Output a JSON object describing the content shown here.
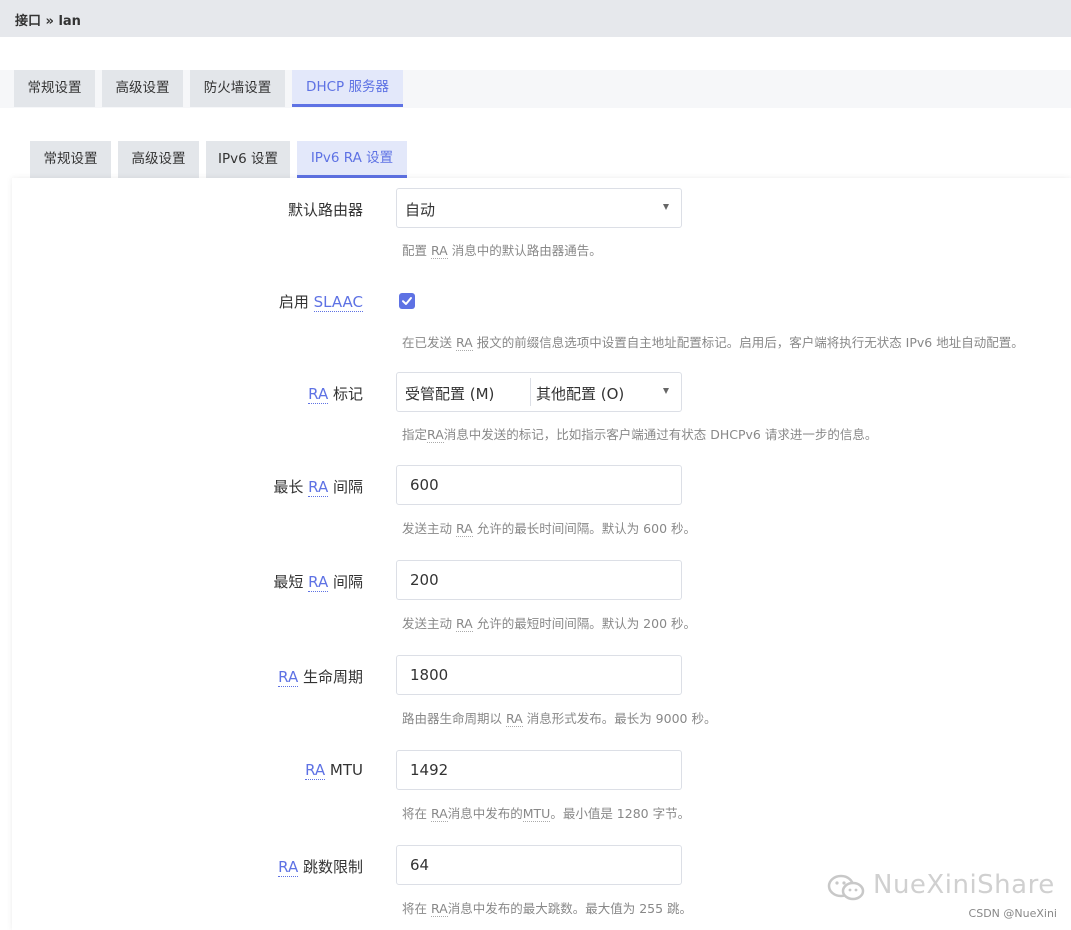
{
  "breadcrumb": "接口 » lan",
  "main_tabs": [
    "常规设置",
    "高级设置",
    "防火墙设置",
    "DHCP 服务器"
  ],
  "sub_tabs": [
    "常规设置",
    "高级设置",
    "IPv6 设置",
    "IPv6 RA 设置"
  ],
  "fields": {
    "default_router": {
      "label": "默认路由器",
      "value": "自动",
      "help_prefix": "配置 ",
      "help_abbr": "RA",
      "help_suffix": " 消息中的默认路由器通告。"
    },
    "slaac": {
      "label_prefix": "启用 ",
      "label_abbr": "SLAAC",
      "checked": true,
      "help_prefix": "在已发送 ",
      "help_abbr": "RA",
      "help_suffix": " 报文的前缀信息选项中设置自主地址配置标记。启用后，客户端将执行无状态 IPv6 地址自动配置。"
    },
    "ra_flags": {
      "label_abbr": "RA",
      "label_suffix": " 标记",
      "value1": "受管配置 (M)",
      "value2": "其他配置 (O)",
      "help_prefix": "指定",
      "help_abbr": "RA",
      "help_suffix": "消息中发送的标记，比如指示客户端通过有状态 DHCPv6 请求进一步的信息。"
    },
    "max_interval": {
      "label_prefix": "最长 ",
      "label_abbr": "RA",
      "label_suffix": " 间隔",
      "value": "600",
      "help_prefix": "发送主动 ",
      "help_abbr": "RA",
      "help_suffix": " 允许的最长时间间隔。默认为 600 秒。"
    },
    "min_interval": {
      "label_prefix": "最短 ",
      "label_abbr": "RA",
      "label_suffix": " 间隔",
      "value": "200",
      "help_prefix": "发送主动 ",
      "help_abbr": "RA",
      "help_suffix": " 允许的最短时间间隔。默认为 200 秒。"
    },
    "lifetime": {
      "label_abbr": "RA",
      "label_suffix": " 生命周期",
      "value": "1800",
      "help_prefix": "路由器生命周期以 ",
      "help_abbr": "RA",
      "help_suffix": " 消息形式发布。最长为 9000 秒。"
    },
    "mtu": {
      "label_abbr": "RA",
      "label_suffix": " MTU",
      "value": "1492",
      "help_prefix": "将在 ",
      "help_abbr": "RA",
      "help_mid": "消息中发布的",
      "help_abbr2": "MTU",
      "help_suffix": "。最小值是 1280 字节。"
    },
    "hoplimit": {
      "label_abbr": "RA",
      "label_suffix": " 跳数限制",
      "value": "64",
      "help_prefix": "将在 ",
      "help_abbr": "RA",
      "help_suffix": "消息中发布的最大跳数。最大值为 255 跳。"
    }
  },
  "watermark": "NueXiniShare",
  "csdn": "CSDN @NueXini",
  "colors": {
    "accent": "#5e72e4",
    "tab_bg": "#e3e6ea",
    "help": "#888888"
  }
}
